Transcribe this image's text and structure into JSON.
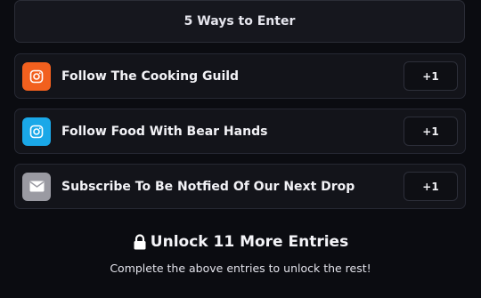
{
  "header": {
    "title": "5 Ways to Enter"
  },
  "entries": [
    {
      "label": "Follow The Cooking Guild",
      "points": "+1",
      "icon": "instagram-icon",
      "icon_color": "#f2601e"
    },
    {
      "label": "Follow Food With Bear Hands",
      "points": "+1",
      "icon": "instagram-icon",
      "icon_color": "#1aa8e8"
    },
    {
      "label": "Subscribe To Be Notfied Of Our Next Drop",
      "points": "+1",
      "icon": "envelope-icon",
      "icon_color": "#9a9aa2"
    }
  ],
  "unlock": {
    "title": "Unlock 11 More Entries",
    "subtitle": "Complete the above entries to unlock the rest!",
    "icon": "lock-icon"
  }
}
